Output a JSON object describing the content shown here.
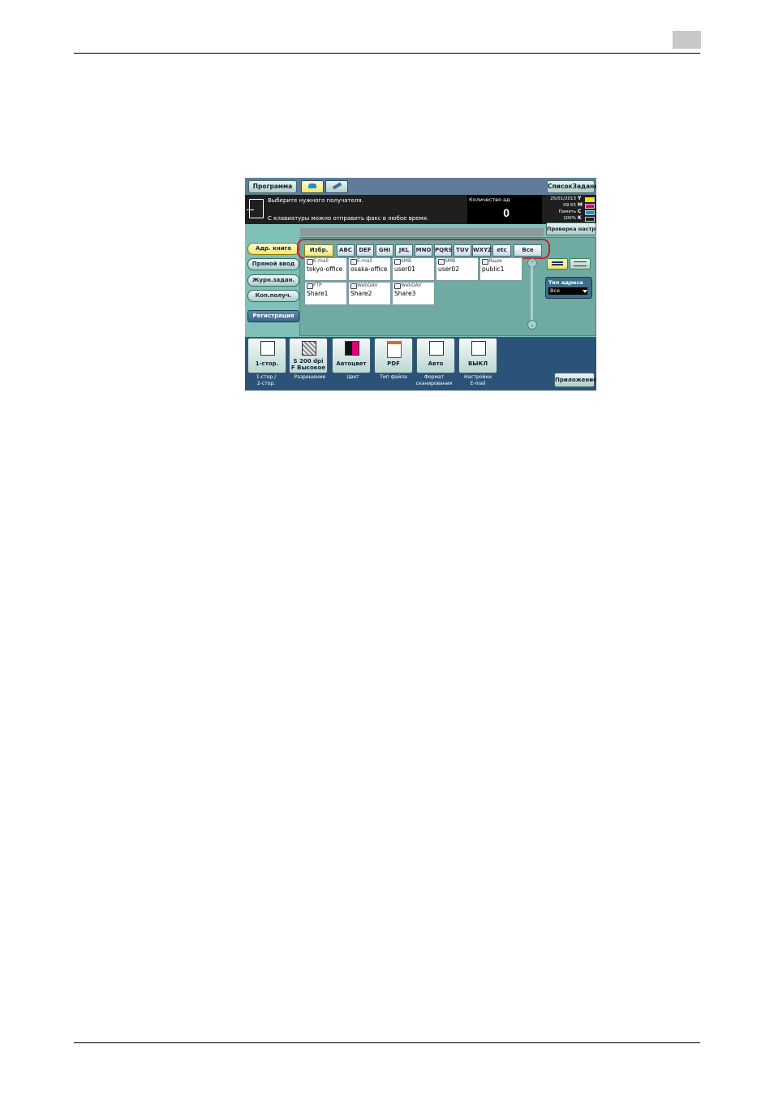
{
  "header": {
    "program_label": "Программа",
    "job_list_label": "СписокЗаданий"
  },
  "message": {
    "line1": "Выберите нужного получателя.",
    "line2": "С клавиатуры можно отправить факс в любое время."
  },
  "counter": {
    "label": "Количество ад",
    "value": "0"
  },
  "status": {
    "datetime": "25/01/2013",
    "time": "09:55",
    "memory_label": "Память",
    "memory_value": "100%",
    "toners": [
      "Y",
      "M",
      "C",
      "K"
    ],
    "toner_colors": [
      "#f4e400",
      "#e0007a",
      "#00a0e0",
      "#202020"
    ]
  },
  "check_settings_label": "Проверка настро",
  "sidebar": {
    "items": [
      {
        "label": "Адр. книга",
        "active": true
      },
      {
        "label": "Прямой ввод"
      },
      {
        "label": "Журн.задан."
      },
      {
        "label": "Коп.получ."
      },
      {
        "label": "Регистрация"
      }
    ]
  },
  "alpha_tabs": [
    {
      "label": "Избр.",
      "selected": true
    },
    {
      "label": "ABC"
    },
    {
      "label": "DEF"
    },
    {
      "label": "GHI"
    },
    {
      "label": "JKL"
    },
    {
      "label": "MNO"
    },
    {
      "label": "PQRS"
    },
    {
      "label": "TUV"
    },
    {
      "label": "WXYZ"
    },
    {
      "label": "etc"
    },
    {
      "label": "Все"
    }
  ],
  "destinations": [
    {
      "type": "E-mail",
      "name": "tokyo-office",
      "icon": "email-icon"
    },
    {
      "type": "E-mail",
      "name": "osaka-office",
      "icon": "email-icon"
    },
    {
      "type": "SMB",
      "name": "user01",
      "icon": "smb-icon"
    },
    {
      "type": "SMB",
      "name": "user02",
      "icon": "smb-icon"
    },
    {
      "type": "Ящик",
      "name": "public1",
      "icon": "box-icon"
    },
    {
      "type": "FTP",
      "name": "Share1",
      "icon": "ftp-icon"
    },
    {
      "type": "WebDAV",
      "name": "Share2",
      "icon": "webdav-icon"
    },
    {
      "type": "WebDAV",
      "name": "Share3",
      "icon": "webdav-icon"
    }
  ],
  "address_type": {
    "label": "Тип адреса",
    "value": "Все"
  },
  "functions": [
    {
      "label": "1-стор.",
      "caption": "1-стор./\n2-стор.",
      "icon": "duplex-icon"
    },
    {
      "label": "S 200 dpi\nF Высокое",
      "caption": "Разрешение",
      "icon": "resolution-icon"
    },
    {
      "label": "Автоцвет",
      "caption": "Цвет",
      "icon": "color-icon"
    },
    {
      "label": "PDF",
      "caption": "Тип файла",
      "icon": "pdf-icon"
    },
    {
      "label": "Авто",
      "caption": "Формат\nсканирования",
      "icon": "page-size-icon"
    },
    {
      "label": "ВЫКЛ",
      "caption": "Настройки\nE-mail",
      "icon": "email-settings-icon"
    }
  ],
  "app_label": "Приложение"
}
